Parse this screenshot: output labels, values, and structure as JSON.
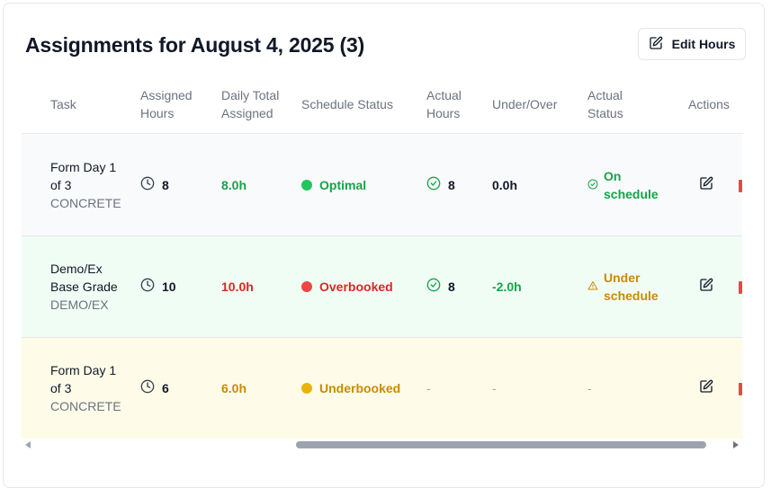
{
  "header": {
    "title": "Assignments for August 4, 2025 (3)",
    "edit_label": "Edit Hours"
  },
  "columns": [
    "Task",
    "Assigned Hours",
    "Daily Total Assigned",
    "Schedule Status",
    "Actual Hours",
    "Under/Over",
    "Actual Status",
    "Actions"
  ],
  "rows": [
    {
      "task_name": "Form Day 1 of 3",
      "task_code": "CONCRETE",
      "assigned_hours": "8",
      "daily_total": "8.0h",
      "schedule_status": "Optimal",
      "actual_hours": "8",
      "under_over": "0.0h",
      "actual_status": "On schedule",
      "row_color": "#f9fafb",
      "status_color": "#22c55e",
      "actual_status_icon": "check-circle-icon"
    },
    {
      "task_name": "Demo/Ex Base Grade",
      "task_code": "DEMO/EX",
      "assigned_hours": "10",
      "daily_total": "10.0h",
      "schedule_status": "Overbooked",
      "actual_hours": "8",
      "under_over": "-2.0h",
      "actual_status": "Under schedule",
      "row_color": "#f0fdf4",
      "status_color": "#ef4444",
      "actual_status_icon": "warning-triangle-icon"
    },
    {
      "task_name": "Form Day 1 of 3",
      "task_code": "CONCRETE",
      "assigned_hours": "6",
      "daily_total": "6.0h",
      "schedule_status": "Underbooked",
      "actual_hours": "-",
      "under_over": "-",
      "actual_status": "-",
      "row_color": "#fefce8",
      "status_color": "#eab308",
      "actual_status_icon": ""
    }
  ],
  "icons": {
    "edit": "edit-icon",
    "clock": "clock-icon",
    "check": "check-circle-icon",
    "warning": "warning-triangle-icon"
  }
}
